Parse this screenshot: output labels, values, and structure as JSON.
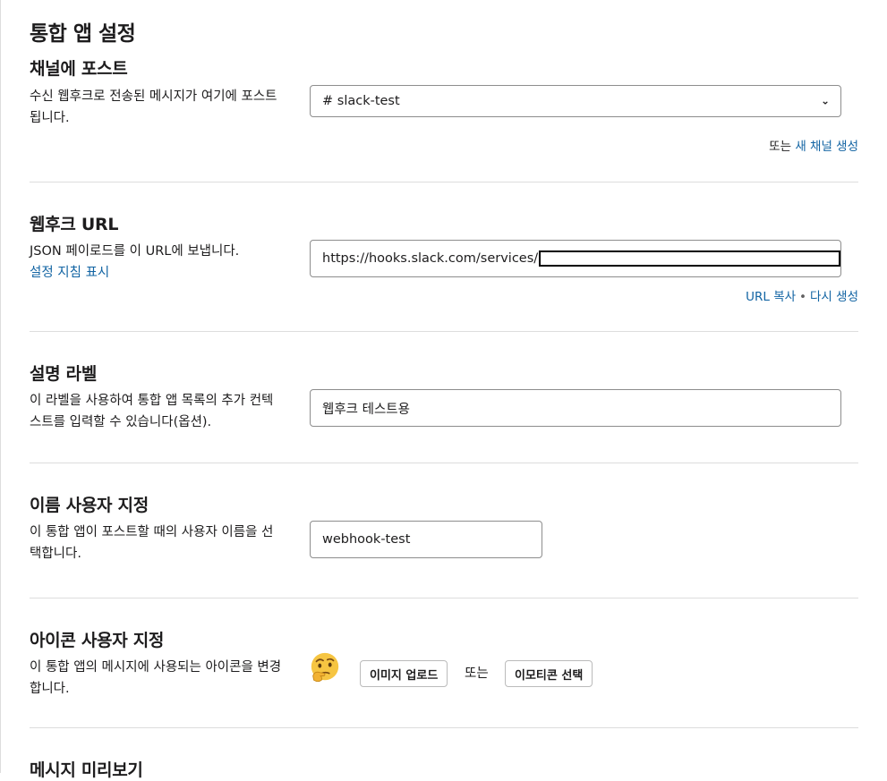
{
  "page": {
    "title": "통합 앱 설정"
  },
  "post_to_channel": {
    "heading": "채널에 포스트",
    "description": "수신 웹후크로 전송된 메시지가 여기에 포스트됩니다.",
    "channel_value": "# slack-test",
    "or_text": "또는",
    "create_channel_link": "새 채널 생성"
  },
  "webhook_url": {
    "heading": "웹후크 URL",
    "description": "JSON 페이로드를 이 URL에 보냅니다.",
    "instructions_link": "설정 지침 표시",
    "url_value": "https://hooks.slack.com/services/",
    "copy_link": "URL 복사",
    "regenerate_link": "다시 생성"
  },
  "descriptive_label": {
    "heading": "설명 라벨",
    "description": "이 라벨을 사용하여 통합 앱 목록의 추가 컨텍스트를 입력할 수 있습니다(옵션).",
    "value": "웹후크 테스트용"
  },
  "custom_name": {
    "heading": "이름 사용자 지정",
    "description": "이 통합 앱이 포스트할 때의 사용자 이름을 선택합니다.",
    "value": "webhook-test"
  },
  "custom_icon": {
    "heading": "아이콘 사용자 지정",
    "description": "이 통합 앱의 메시지에 사용되는 아이콘을 변경합니다.",
    "icon": "thinking-face-emoji",
    "upload_button": "이미지 업로드",
    "or_text": "또는",
    "emoji_button": "이모티콘 선택"
  },
  "message_preview": {
    "heading": "메시지 미리보기"
  },
  "colors": {
    "link": "#1264a3",
    "divider": "#dddddd",
    "border": "#8d8d8d"
  }
}
